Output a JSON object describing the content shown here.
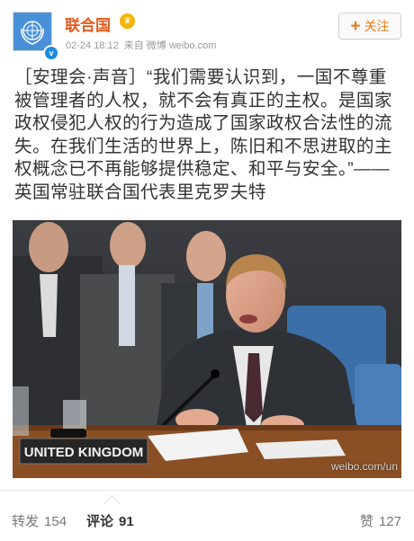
{
  "header": {
    "name": "联合国",
    "timestamp": "02-24 18:12",
    "source": "来自 微博 weibo.com",
    "follow_label": "关注"
  },
  "post": {
    "text": "［安理会·声音］“我们需要认识到，一国不尊重被管理者的人权，就不会有真正的主权。是国家政权侵犯人权的行为造成了国家政权合法性的流失。在我们生活的世界上，陈旧和不思进取的主权概念已不再能够提供稳定、和平与安全。”——英国常驻联合国代表里克罗夫特"
  },
  "photo": {
    "nameplate": "UNITED KINGDOM",
    "watermark": "weibo.com/un"
  },
  "footer": {
    "repost_label": "转发",
    "repost_count": "154",
    "comment_label": "评论",
    "comment_count": "91",
    "like_label": "赞",
    "like_count": "127"
  },
  "colors": {
    "name": "#e85a1c",
    "follow": "#e87b1c",
    "verified": "#1a8be0",
    "avatar": "#4a90d9"
  },
  "icons": [
    "un-logo-icon",
    "verified-icon",
    "vip-icon",
    "plus-icon"
  ]
}
